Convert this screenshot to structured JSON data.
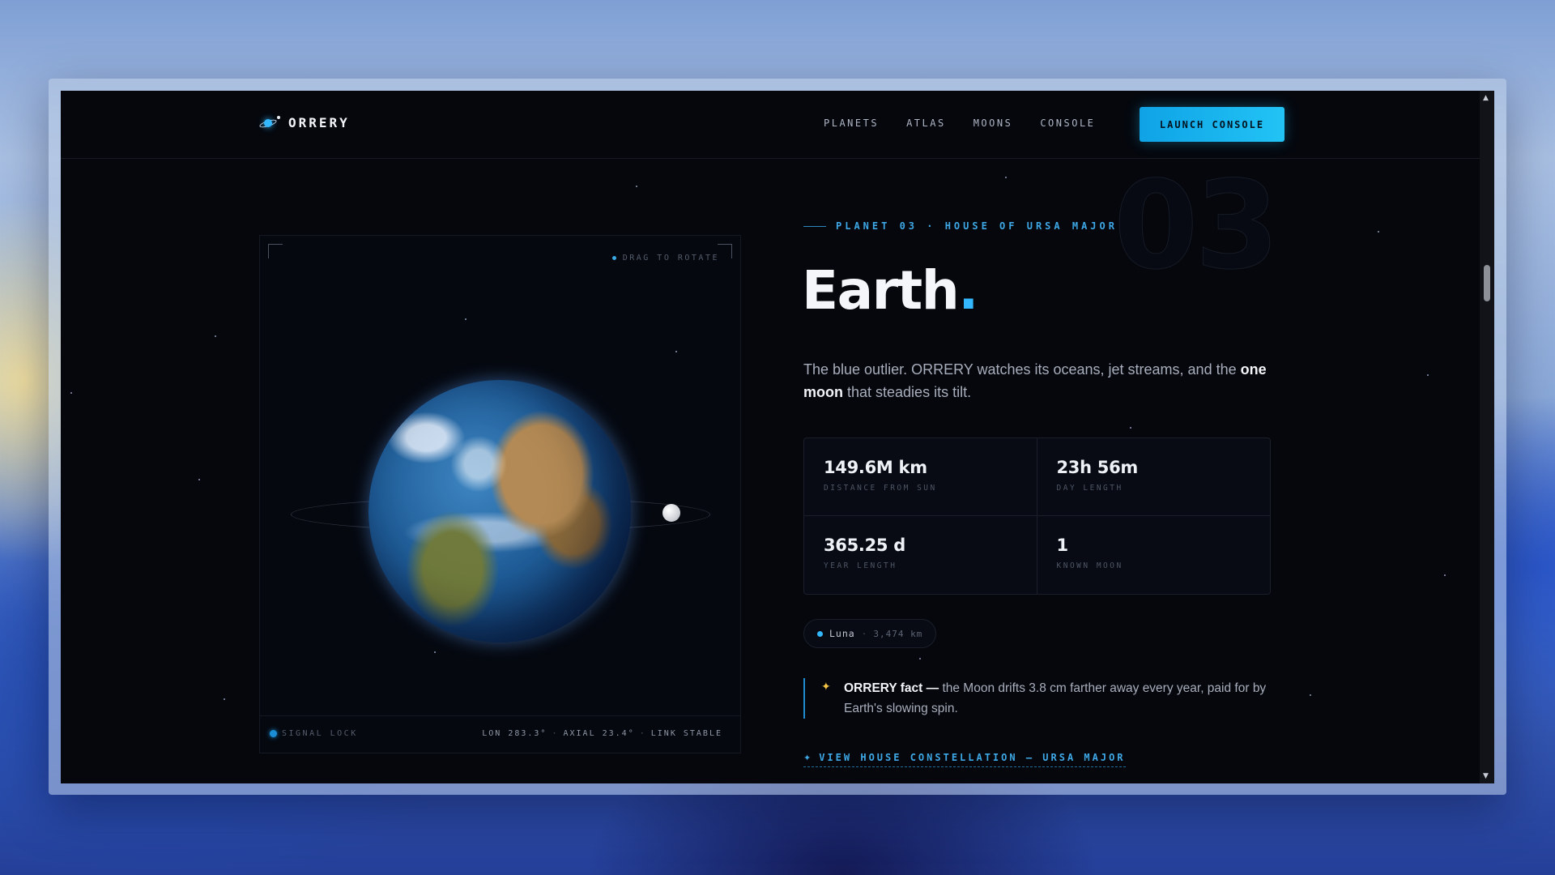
{
  "nav": {
    "logo_text": "ORRERY",
    "links": [
      "PLANETS",
      "ATLAS",
      "MOONS",
      "CONSOLE"
    ],
    "cta_label": "LAUNCH CONSOLE"
  },
  "viewer": {
    "drag_hint": "DRAG TO ROTATE",
    "signal_label": "SIGNAL LOCK",
    "readout": {
      "lon": "LON 283.3°",
      "axial": "AXIAL 23.4°",
      "link": "LINK STABLE",
      "separator": "·"
    }
  },
  "planet": {
    "index_watermark": "03",
    "eyebrow": "PLANET 03 · HOUSE OF URSA MAJOR",
    "name": "Earth",
    "name_dot": ".",
    "lede_before": "The blue outlier. ORRERY watches its oceans, jet streams, and the ",
    "lede_bold": "one moon",
    "lede_after": " that steadies its tilt.",
    "stats": [
      {
        "value": "149.6M km",
        "label": "DISTANCE FROM SUN"
      },
      {
        "value": "23h 56m",
        "label": "DAY LENGTH"
      },
      {
        "value": "365.25 d",
        "label": "YEAR LENGTH"
      },
      {
        "value": "1",
        "label": "KNOWN MOON"
      }
    ],
    "moon_chip": {
      "name": "Luna",
      "separator": "·",
      "size": "3,474 km"
    },
    "fact": {
      "star": "✦",
      "lead": "ORRERY fact —",
      "text": " the Moon drifts 3.8 cm farther away every year, paid for by Earth's slowing spin."
    },
    "house_link": {
      "arrow": "✦",
      "label": "VIEW HOUSE CONSTELLATION — URSA MAJOR"
    }
  },
  "colors": {
    "accent": "#33b8ff",
    "cta_bg": "#1ab4ef",
    "background": "#05070d",
    "fact_star": "#f3c343"
  },
  "icons": {
    "logo": "orrery-logo-icon",
    "scroll_up": "arrow-up-icon",
    "scroll_down": "arrow-down-icon"
  }
}
